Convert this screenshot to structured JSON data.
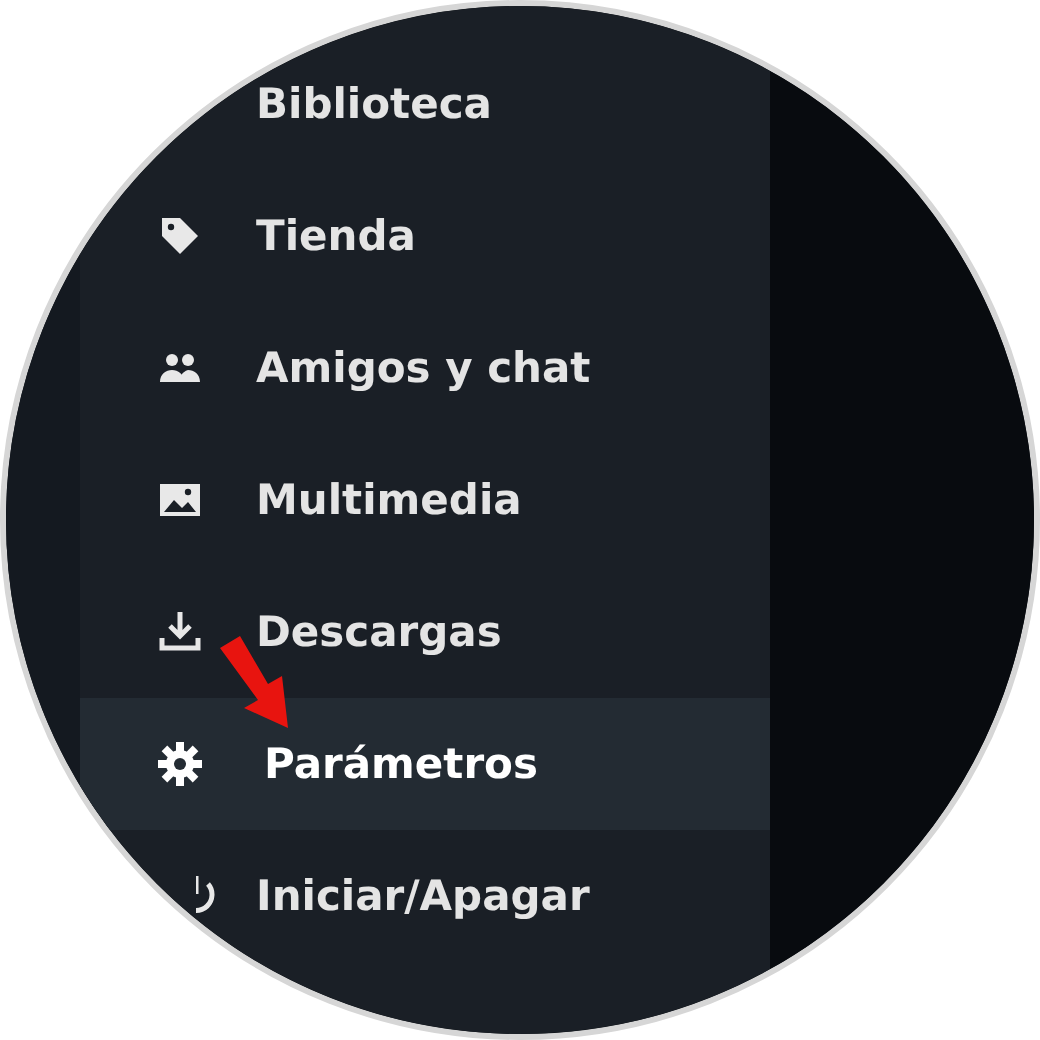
{
  "menu": {
    "items": [
      {
        "label": "Biblioteca",
        "selected": false
      },
      {
        "label": "Tienda",
        "selected": false
      },
      {
        "label": "Amigos y chat",
        "selected": false
      },
      {
        "label": "Multimedia",
        "selected": false
      },
      {
        "label": "Descargas",
        "selected": false
      },
      {
        "label": "Parámetros",
        "selected": true
      },
      {
        "label": "Iniciar/Apagar",
        "selected": false
      }
    ]
  }
}
